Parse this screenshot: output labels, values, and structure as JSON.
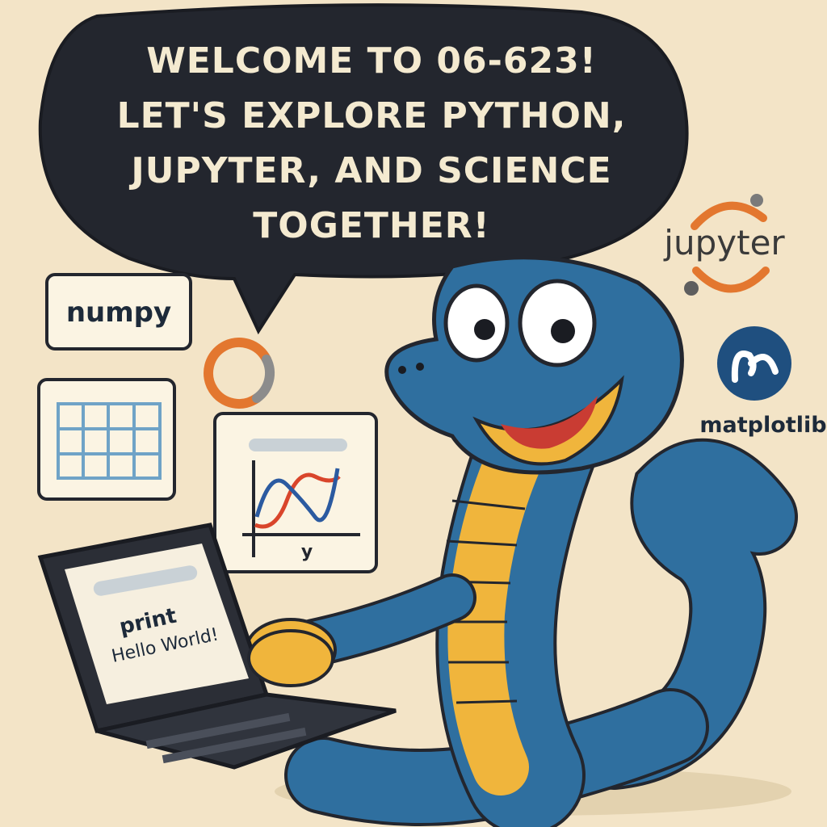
{
  "speech_bubble": {
    "line1": "WELCOME TO 06-623!",
    "line2": "LET'S EXPLORE PYTHON,",
    "line3": "JUPYTER, AND SCIENCE",
    "line4": "TOGETHER!"
  },
  "cards": {
    "numpy_label": "numpy"
  },
  "logos": {
    "jupyter_label": "jupyter",
    "matplotlib_label": "matplotlib"
  },
  "plot_card": {
    "axis_label": "y"
  },
  "laptop": {
    "code_line1": "print",
    "code_line2": "Hello World!"
  },
  "colors": {
    "background": "#f3e4c7",
    "bubble": "#23262e",
    "snake_blue": "#2f6f9f",
    "snake_belly": "#f0b53c",
    "jupyter_orange": "#e3772f",
    "matplotlib_blue": "#1f4f7f",
    "plot_red": "#d9452b",
    "plot_blue": "#2b5aa0"
  },
  "icons": [
    "jupyter-logo-icon",
    "matplotlib-logo-icon",
    "orange-ring-icon",
    "table-grid-icon",
    "line-plot-icon",
    "laptop-icon",
    "python-snake-mascot"
  ]
}
